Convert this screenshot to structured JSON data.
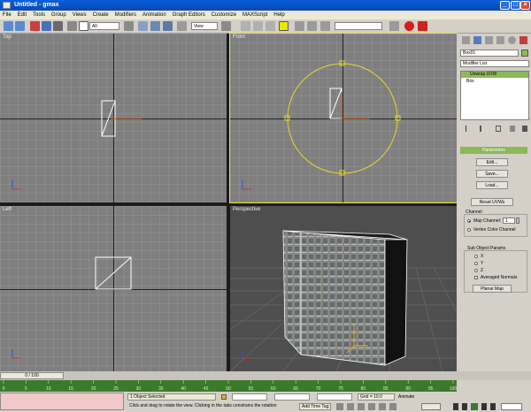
{
  "window": {
    "title": "Untitled - gmax",
    "minimize": "_",
    "maximize": "□",
    "close": "×"
  },
  "menu": [
    "File",
    "Edit",
    "Tools",
    "Group",
    "Views",
    "Create",
    "Modifiers",
    "Animation",
    "Graph Editors",
    "Customize",
    "MAXScript",
    "Help"
  ],
  "toolbar": {
    "selection_filter": "All",
    "ref_coord": "View"
  },
  "viewports": {
    "top": {
      "label": "Top"
    },
    "front": {
      "label": "Front"
    },
    "left": {
      "label": "Left"
    },
    "perspective": {
      "label": "Perspective"
    }
  },
  "command_panel": {
    "object_name": "Box01",
    "modifier_list": "Modifier List",
    "stack": [
      "Unwrap UVW",
      "Box"
    ],
    "parameters_title": "Parameters",
    "edit_button": "Edit...",
    "save_button": "Save...",
    "load_button": "Load...",
    "reset_button": "Reset UVWs",
    "channel_label": "Channel",
    "map_channel_label": "Map Channel:",
    "map_channel_value": "1",
    "vertex_color_label": "Vertex Color Channel",
    "subobject_label": "Sub Object Params",
    "axis_x": "X",
    "axis_y": "Y",
    "axis_z": "Z",
    "averaged_normals": "Averaged Normals",
    "planar_map_button": "Planar Map"
  },
  "timeline": {
    "frame": "0 / 100",
    "ticks": [
      "0",
      "5",
      "10",
      "15",
      "20",
      "25",
      "30",
      "35",
      "40",
      "45",
      "50",
      "55",
      "60",
      "65",
      "70",
      "75",
      "80",
      "85",
      "90",
      "95",
      "100"
    ]
  },
  "status": {
    "selection": "1 Object Selected",
    "prompt": "Click and drag to rotate the view. Clicking in the tabs constrains the rotation",
    "add_time_tag": "Add Time Tag",
    "grid": "Grid = 10.0",
    "animate": "Animate"
  },
  "colors": {
    "accent": "#8cb85a",
    "selection_circle": "#e8d82a",
    "titlebar": "#0a5fd8"
  }
}
